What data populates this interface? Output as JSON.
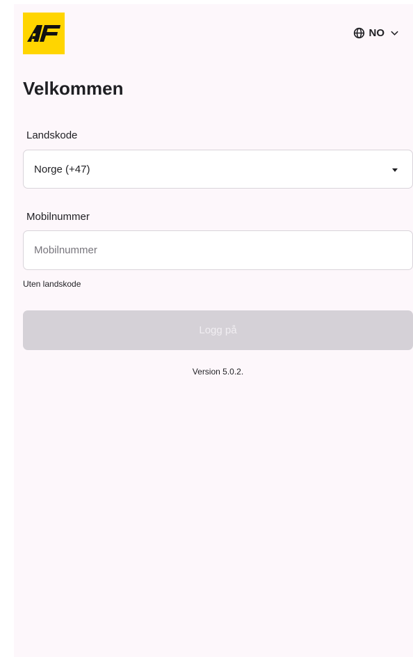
{
  "brand": {
    "logo_text": "AF",
    "logo_color": "#ffd500"
  },
  "language": {
    "icon": "globe-icon",
    "code": "NO",
    "chevron_icon": "chevron-down-icon"
  },
  "title": "Velkommen",
  "country_code": {
    "label": "Landskode",
    "selected": "Norge (+47)",
    "icon": "caret-down-icon"
  },
  "mobile": {
    "label": "Mobilnummer",
    "placeholder": "Mobilnummer",
    "value": "",
    "helper": "Uten landskode"
  },
  "login": {
    "label": "Logg på",
    "disabled": true
  },
  "footer": {
    "version": "Version 5.0.2."
  },
  "colors": {
    "background": "#fdf7fb",
    "accent": "#ffd500",
    "disabled_button": "#d5d1d7"
  }
}
